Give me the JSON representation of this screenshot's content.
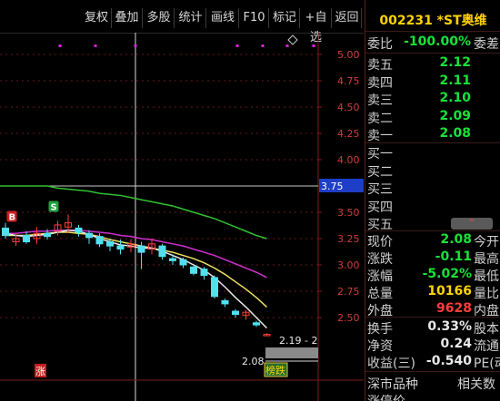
{
  "toolbar": {
    "buttons": [
      "复权",
      "叠加",
      "多股",
      "统计",
      "画线",
      "F10",
      "标记",
      "+自选",
      "返回"
    ]
  },
  "chart": {
    "price_axis": [
      "5.00",
      "4.75",
      "4.50",
      "4.25",
      "4.00",
      "3.75",
      "3.50",
      "3.25",
      "3.00",
      "2.75",
      "2.50"
    ],
    "crosshair_price": "3.75",
    "low_price_tag": "2.08",
    "range_text": "2.19 - 2",
    "marker_b": "B",
    "marker_s": "S",
    "bottom_tag": "涨",
    "ranking_tag": "榜跌",
    "colors": {
      "up": "#ff3c3c",
      "down": "#52e0f0",
      "ma_white": "#e8e8e8",
      "ma_yellow": "#f0e060",
      "ma_magenta": "#d030d0",
      "ma_green": "#30c030"
    }
  },
  "chart_data": {
    "type": "candlestick",
    "ylim": [
      2.35,
      5.1
    ],
    "candles": [
      {
        "o": 3.35,
        "c": 3.28,
        "h": 3.4,
        "l": 3.25
      },
      {
        "o": 3.22,
        "c": 3.25,
        "h": 3.3,
        "l": 3.18
      },
      {
        "o": 3.28,
        "c": 3.22,
        "h": 3.32,
        "l": 3.2
      },
      {
        "o": 3.25,
        "c": 3.3,
        "h": 3.36,
        "l": 3.2
      },
      {
        "o": 3.3,
        "c": 3.27,
        "h": 3.34,
        "l": 3.24
      },
      {
        "o": 3.32,
        "c": 3.38,
        "h": 3.42,
        "l": 3.28
      },
      {
        "o": 3.36,
        "c": 3.4,
        "h": 3.48,
        "l": 3.3
      },
      {
        "o": 3.35,
        "c": 3.31,
        "h": 3.38,
        "l": 3.27
      },
      {
        "o": 3.3,
        "c": 3.26,
        "h": 3.33,
        "l": 3.2
      },
      {
        "o": 3.27,
        "c": 3.2,
        "h": 3.3,
        "l": 3.17
      },
      {
        "o": 3.22,
        "c": 3.18,
        "h": 3.25,
        "l": 3.13
      },
      {
        "o": 3.18,
        "c": 3.15,
        "h": 3.24,
        "l": 3.1
      },
      {
        "o": 3.17,
        "c": 3.2,
        "h": 3.24,
        "l": 3.12
      },
      {
        "o": 3.18,
        "c": 3.12,
        "h": 3.22,
        "l": 2.96
      },
      {
        "o": 3.15,
        "c": 3.2,
        "h": 3.25,
        "l": 3.1
      },
      {
        "o": 3.18,
        "c": 3.08,
        "h": 3.2,
        "l": 3.05
      },
      {
        "o": 3.06,
        "c": 3.04,
        "h": 3.1,
        "l": 3.0
      },
      {
        "o": 3.05,
        "c": 3.0,
        "h": 3.07,
        "l": 2.97
      },
      {
        "o": 2.98,
        "c": 2.92,
        "h": 3.0,
        "l": 2.9
      },
      {
        "o": 2.96,
        "c": 2.9,
        "h": 2.98,
        "l": 2.86
      },
      {
        "o": 2.88,
        "c": 2.7,
        "h": 2.9,
        "l": 2.68
      },
      {
        "o": 2.66,
        "c": 2.63,
        "h": 2.68,
        "l": 2.6
      },
      {
        "o": 2.56,
        "c": 2.53,
        "h": 2.58,
        "l": 2.5
      },
      {
        "o": 2.52,
        "c": 2.55,
        "h": 2.57,
        "l": 2.48
      },
      {
        "o": 2.45,
        "c": 2.43,
        "h": 2.47,
        "l": 2.41
      },
      {
        "o": 2.34,
        "c": 2.34,
        "h": 2.35,
        "l": 2.33
      }
    ],
    "ma_white": [
      3.3,
      3.28,
      3.27,
      3.28,
      3.29,
      3.31,
      3.33,
      3.32,
      3.29,
      3.25,
      3.22,
      3.19,
      3.18,
      3.16,
      3.16,
      3.13,
      3.09,
      3.05,
      3.0,
      2.95,
      2.88,
      2.79,
      2.69,
      2.6,
      2.5,
      2.4
    ],
    "ma_yellow": [
      3.28,
      3.28,
      3.28,
      3.29,
      3.3,
      3.31,
      3.31,
      3.3,
      3.29,
      3.27,
      3.24,
      3.22,
      3.2,
      3.18,
      3.16,
      3.14,
      3.12,
      3.09,
      3.06,
      3.02,
      2.97,
      2.91,
      2.84,
      2.77,
      2.69,
      2.6
    ],
    "ma_magenta": [
      3.3,
      3.3,
      3.31,
      3.32,
      3.32,
      3.33,
      3.33,
      3.33,
      3.32,
      3.31,
      3.3,
      3.28,
      3.27,
      3.25,
      3.24,
      3.22,
      3.2,
      3.18,
      3.15,
      3.12,
      3.09,
      3.05,
      3.01,
      2.97,
      2.93,
      2.88
    ],
    "ma_green": [
      3.75,
      3.75,
      3.75,
      3.75,
      3.75,
      3.73,
      3.72,
      3.71,
      3.7,
      3.68,
      3.67,
      3.66,
      3.64,
      3.62,
      3.6,
      3.58,
      3.56,
      3.53,
      3.5,
      3.47,
      3.44,
      3.4,
      3.36,
      3.32,
      3.28,
      3.25
    ]
  },
  "panel": {
    "code_name": "002231 *ST奥维",
    "wei_bi": {
      "label": "委比",
      "value": "-100.00%",
      "trail": "委差"
    },
    "sell": [
      {
        "label": "卖五",
        "value": "2.12"
      },
      {
        "label": "卖四",
        "value": "2.11"
      },
      {
        "label": "卖三",
        "value": "2.10"
      },
      {
        "label": "卖二",
        "value": "2.09"
      },
      {
        "label": "卖一",
        "value": "2.08"
      }
    ],
    "buy": [
      "买一",
      "买二",
      "买三",
      "买四",
      "买五"
    ],
    "quotes": [
      {
        "label": "现价",
        "value": "2.08",
        "trail": "今开",
        "color": "green"
      },
      {
        "label": "涨跌",
        "value": "-0.11",
        "trail": "最高",
        "color": "green"
      },
      {
        "label": "涨幅",
        "value": "-5.02%",
        "trail": "最低",
        "color": "green"
      },
      {
        "label": "总量",
        "value": "10166",
        "trail": "量比",
        "color": "yellow"
      },
      {
        "label": "外盘",
        "value": "9628",
        "trail": "内盘",
        "color": "red"
      }
    ],
    "stats": [
      {
        "label": "换手",
        "value": "0.33%",
        "trail": "股本"
      },
      {
        "label": "净资",
        "value": "0.24",
        "trail": "流通"
      },
      {
        "label": "收益(三)",
        "value": "-0.540",
        "trail": "PE(动"
      }
    ],
    "footer": {
      "left": "深市品种",
      "right": "相关数",
      "next": "涨停价"
    }
  }
}
